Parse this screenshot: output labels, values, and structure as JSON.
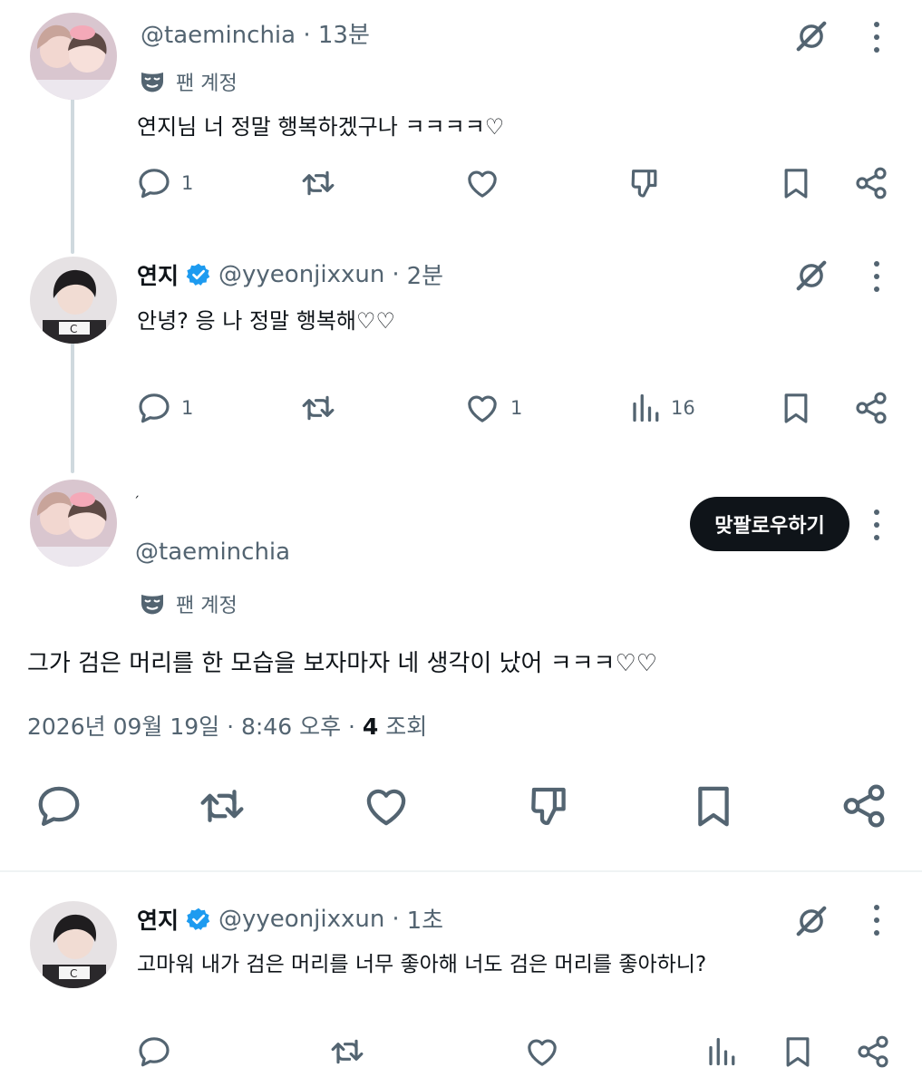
{
  "tweets": [
    {
      "handle": "@taeminchia",
      "time": "13분",
      "fan_label": "팬 계정",
      "text": "연지님 너 정말 행복하겠구나 ㅋㅋㅋㅋ♡",
      "reply_count": "1"
    },
    {
      "name": "연지",
      "handle": "@yyeonjixxun",
      "time": "2분",
      "text": "안녕? 응 나 정말 행복해♡♡",
      "reply_count": "1",
      "like_count": "1",
      "view_count": "16"
    }
  ],
  "focused": {
    "display_name": "ˏ",
    "handle": "@taeminchia",
    "follow_button": "맞팔로우하기",
    "fan_label": "팬 계정",
    "text": "그가 검은 머리를 한 모습을 보자마자 네 생각이 났어 ㅋㅋㅋ♡♡",
    "date": "2026년 09월 19일 · 8:46 오후 · ",
    "views": "4",
    "views_label": " 조회"
  },
  "reply": {
    "name": "연지",
    "handle": "@yyeonjixxun",
    "time": "1초",
    "text": "고마워 내가 검은 머리를 너무 좋아해 너도 검은 머리를 좋아하니?"
  },
  "colors": {
    "text_primary": "#0f1419",
    "text_secondary": "#536471",
    "verified_blue": "#1d9bf0",
    "thread_line": "#cfd9de"
  },
  "icons": [
    "reply-icon",
    "retweet-icon",
    "like-icon",
    "dislike-icon",
    "bookmark-icon",
    "share-icon",
    "views-icon",
    "grok-icon",
    "more-icon",
    "fan-mask-icon",
    "verified-icon"
  ]
}
